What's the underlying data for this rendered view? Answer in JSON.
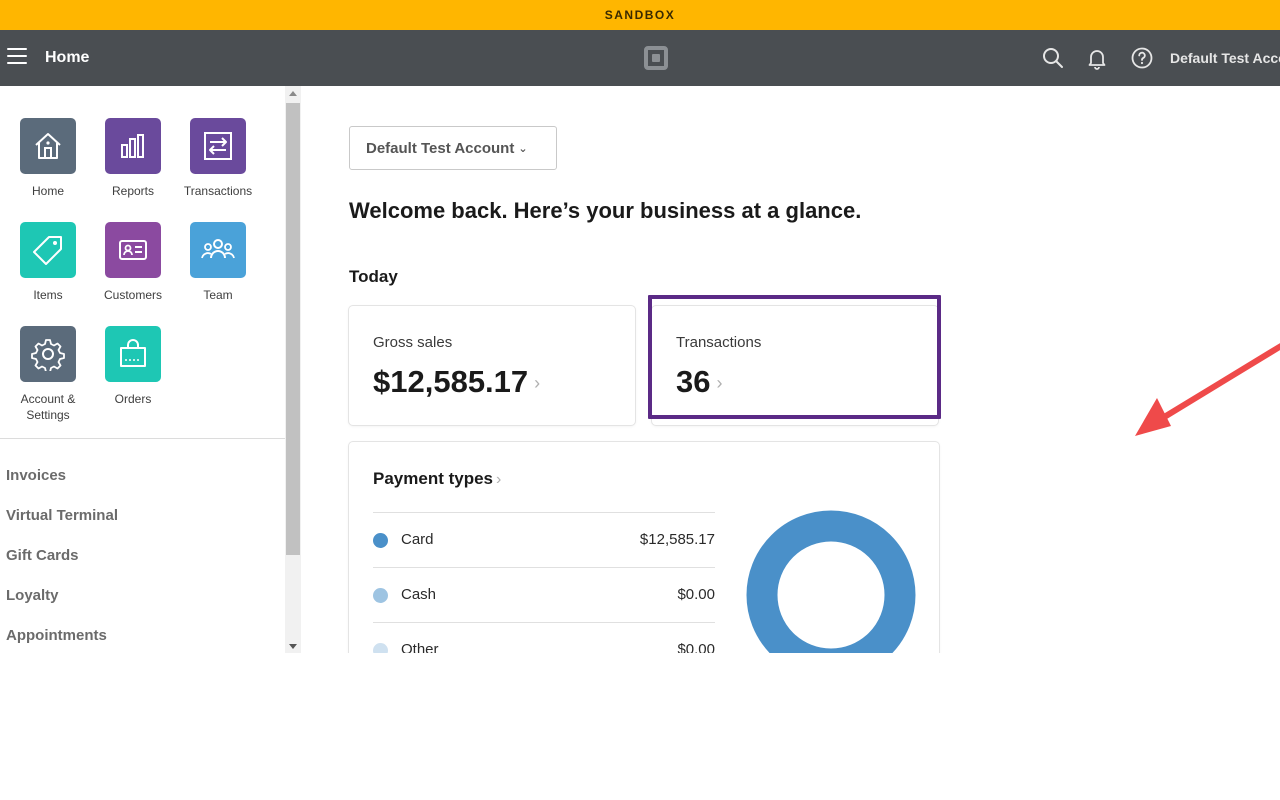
{
  "banner": {
    "text": "SANDBOX"
  },
  "topbar": {
    "title": "Home",
    "account_name": "Default Test Acco",
    "icons": [
      "menu-icon",
      "square-logo-icon",
      "search-icon",
      "bell-icon",
      "help-icon"
    ]
  },
  "sidebar": {
    "apps": [
      {
        "label": "Home",
        "icon": "home-icon",
        "color": "#5b6b7b"
      },
      {
        "label": "Reports",
        "icon": "bar-chart-icon",
        "color": "#6a4a9c"
      },
      {
        "label": "Transactions",
        "icon": "transfer-arrows-icon",
        "color": "#6a4a9c"
      },
      {
        "label": "Items",
        "icon": "tag-icon",
        "color": "#1ec7b4"
      },
      {
        "label": "Customers",
        "icon": "contact-card-icon",
        "color": "#8b4aa0"
      },
      {
        "label": "Team",
        "icon": "team-icon",
        "color": "#4aa2d9"
      },
      {
        "label": "Account &",
        "label2": "Settings",
        "icon": "gear-icon",
        "color": "#5b6b7b"
      },
      {
        "label": "Orders",
        "icon": "shopping-bag-icon",
        "color": "#1ec7b4"
      }
    ],
    "links": [
      "Invoices",
      "Virtual Terminal",
      "Gift Cards",
      "Loyalty",
      "Appointments"
    ]
  },
  "main": {
    "account_dropdown": "Default Test Account",
    "welcome": "Welcome back. Here’s your business at a glance.",
    "section": "Today",
    "gross_sales": {
      "label": "Gross sales",
      "value": "$12,585.17"
    },
    "transactions": {
      "label": "Transactions",
      "value": "36"
    },
    "payment_types": {
      "title": "Payment types",
      "rows": [
        {
          "name": "Card",
          "amount": "$12,585.17",
          "color": "#4a90c9"
        },
        {
          "name": "Cash",
          "amount": "$0.00",
          "color": "#9ec4e2"
        },
        {
          "name": "Other",
          "amount": "$0.00",
          "color": "#cfe1f0"
        }
      ]
    }
  },
  "annotation": {
    "highlight_color": "#5b2a86",
    "arrow_color": "#ef4a4a"
  }
}
